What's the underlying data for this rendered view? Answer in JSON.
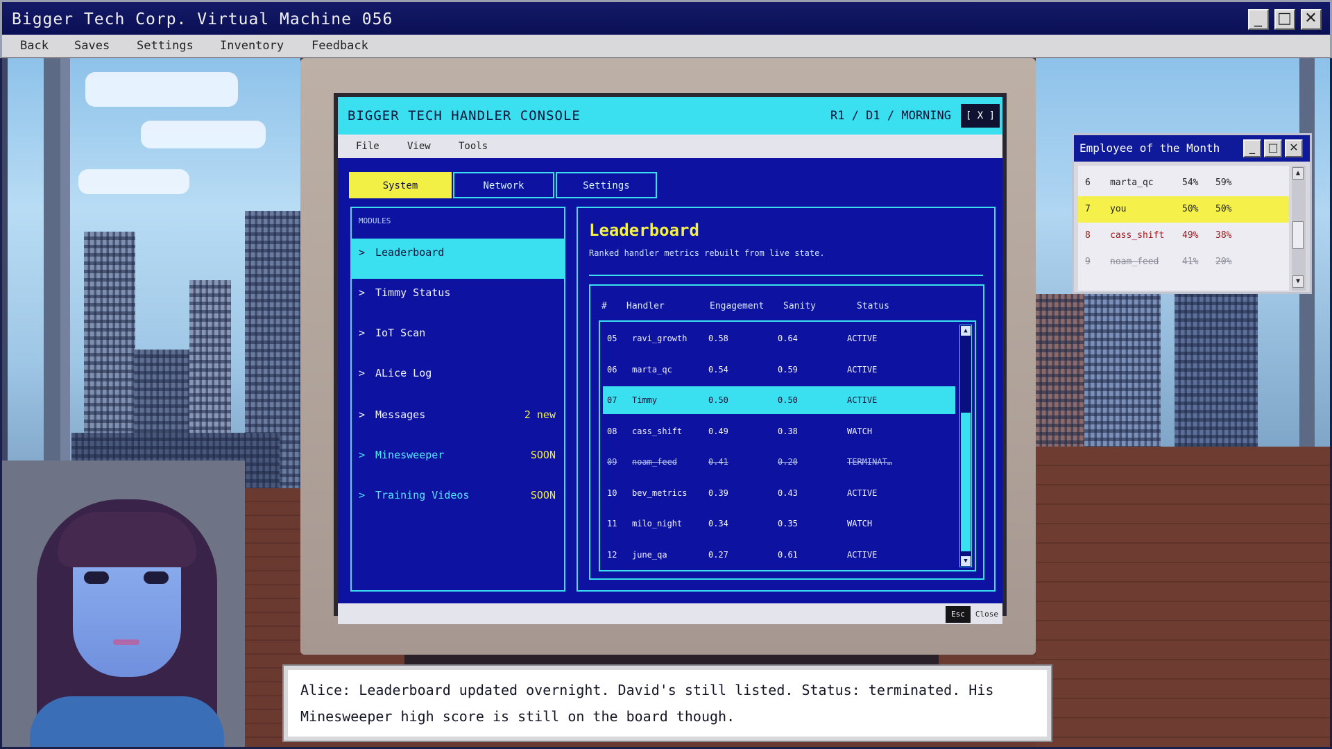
{
  "vm": {
    "title": "Bigger Tech Corp. Virtual Machine 056",
    "menu": [
      "Back",
      "Saves",
      "Settings",
      "Inventory",
      "Feedback"
    ]
  },
  "console": {
    "title": "BIGGER TECH HANDLER CONSOLE",
    "clock": "R1 / D1 / MORNING",
    "close_label": "[ X ]",
    "menu": [
      "File",
      "View",
      "Tools"
    ],
    "tabs": [
      {
        "label": "System",
        "active": true
      },
      {
        "label": "Network",
        "active": false
      },
      {
        "label": "Settings",
        "active": false
      }
    ],
    "modules_header": "MODULES",
    "modules": [
      {
        "label": "Leaderboard",
        "badge": "",
        "active": true
      },
      {
        "label": "Timmy Status",
        "badge": ""
      },
      {
        "label": "IoT Scan",
        "badge": ""
      },
      {
        "label": "ALice Log",
        "badge": ""
      },
      {
        "label": "Messages",
        "badge": "2 new"
      },
      {
        "label": "Minesweeper",
        "badge": "SOON"
      },
      {
        "label": "Training Videos",
        "badge": "SOON"
      }
    ],
    "panel": {
      "title": "Leaderboard",
      "subtitle": "Ranked handler metrics rebuilt from live state.",
      "columns": [
        "#",
        "Handler",
        "Engagement",
        "Sanity",
        "Status"
      ],
      "rows": [
        {
          "rank": "05",
          "handler": "ravi_growth",
          "engagement": "0.58",
          "sanity": "0.64",
          "status": "ACTIVE"
        },
        {
          "rank": "06",
          "handler": "marta_qc",
          "engagement": "0.54",
          "sanity": "0.59",
          "status": "ACTIVE"
        },
        {
          "rank": "07",
          "handler": "Timmy",
          "engagement": "0.50",
          "sanity": "0.50",
          "status": "ACTIVE",
          "highlight": true
        },
        {
          "rank": "08",
          "handler": "cass_shift",
          "engagement": "0.49",
          "sanity": "0.38",
          "status": "WATCH"
        },
        {
          "rank": "09",
          "handler": "noam_feed",
          "engagement": "0.41",
          "sanity": "0.20",
          "status": "TERMINAT…",
          "terminated": true
        },
        {
          "rank": "10",
          "handler": "bev_metrics",
          "engagement": "0.39",
          "sanity": "0.43",
          "status": "ACTIVE"
        },
        {
          "rank": "11",
          "handler": "milo_night",
          "engagement": "0.34",
          "sanity": "0.35",
          "status": "WATCH"
        },
        {
          "rank": "12",
          "handler": "june_qa",
          "engagement": "0.27",
          "sanity": "0.61",
          "status": "ACTIVE"
        }
      ]
    },
    "footer": {
      "key": "Esc",
      "label": "Close"
    }
  },
  "eotm": {
    "title": "Employee of the Month",
    "rows": [
      {
        "rank": "6",
        "name": "marta_qc",
        "a": "54%",
        "b": "59%"
      },
      {
        "rank": "7",
        "name": "you",
        "a": "50%",
        "b": "50%",
        "style": "you"
      },
      {
        "rank": "8",
        "name": "cass_shift",
        "a": "49%",
        "b": "38%",
        "style": "red"
      },
      {
        "rank": "9",
        "name": "noam_feed",
        "a": "41%",
        "b": "20%",
        "style": "faded"
      }
    ]
  },
  "dialogue": {
    "text": "Alice: Leaderboard updated overnight. David's still listed. Status: terminated. His Minesweeper high score is still on the board though."
  },
  "colors": {
    "screen_bg": "#0d12a0",
    "accent_cyan": "#3ae0ef",
    "accent_yellow": "#f2ef45",
    "titlebar_blue": "#0e1a9a"
  }
}
